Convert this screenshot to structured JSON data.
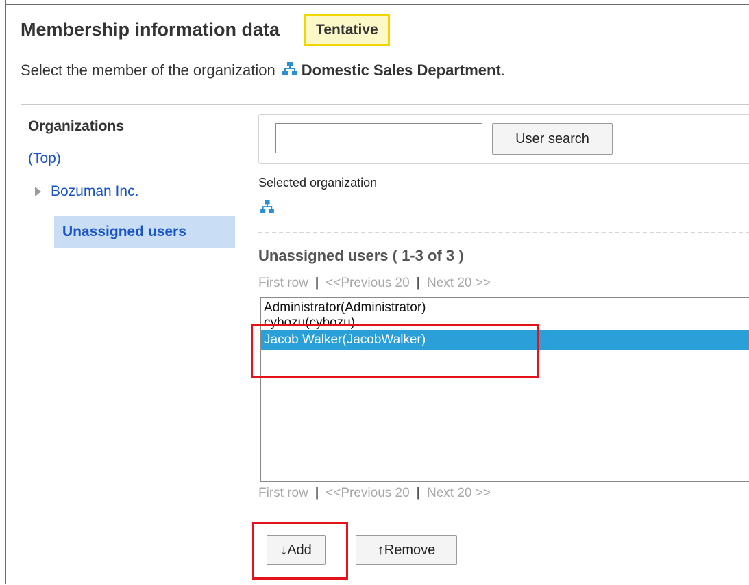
{
  "header": {
    "title": "Membership information data",
    "badge": "Tentative",
    "subtitle_prefix": "Select the member of the organization",
    "org_name": "Domestic Sales Department",
    "subtitle_suffix": "."
  },
  "sidebar": {
    "heading": "Organizations",
    "top_link": "(Top)",
    "tree": [
      {
        "label": "Bozuman Inc.",
        "collapsed": true
      }
    ],
    "selected_item": "Unassigned users"
  },
  "search": {
    "input_value": "",
    "button_label": "User search"
  },
  "selection": {
    "label": "Selected organization"
  },
  "list": {
    "title": "Unassigned users ( 1-3 of 3 )",
    "pager": {
      "first": "First row",
      "prev": "<<Previous 20",
      "next": "Next 20 >>",
      "separator": "|"
    },
    "options": [
      {
        "label": "Administrator(Administrator)",
        "selected": false
      },
      {
        "label": "cybozu(cybozu)",
        "selected": false
      },
      {
        "label": "Jacob Walker(JacobWalker)",
        "selected": true
      }
    ]
  },
  "actions": {
    "add_label": "↓Add",
    "remove_label": "↑Remove"
  },
  "colors": {
    "link": "#1a55c8",
    "selected_bg": "#2a9fd8",
    "highlight_red": "#e3121b",
    "badge_border": "#f2d400"
  }
}
